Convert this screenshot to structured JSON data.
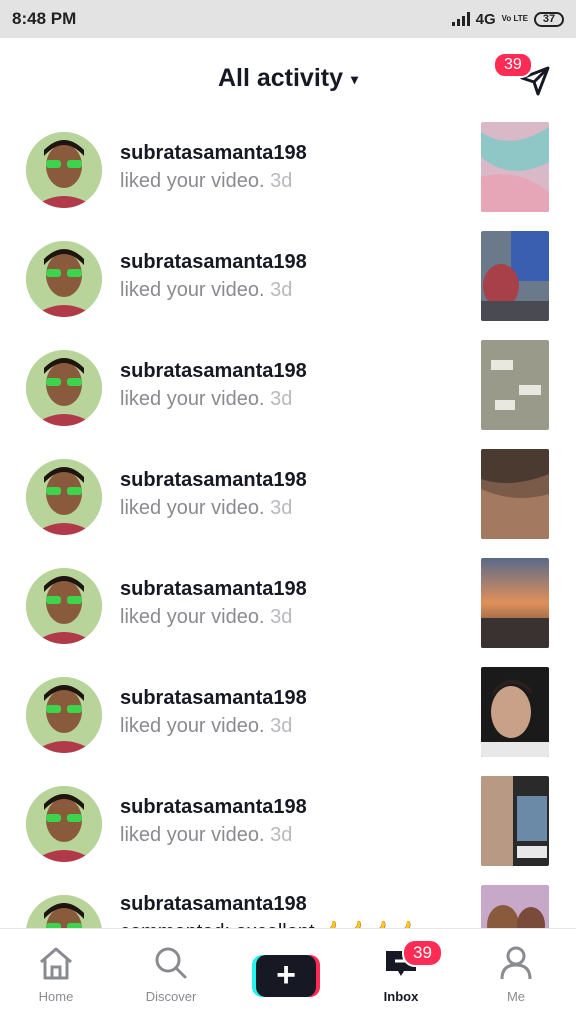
{
  "status": {
    "time": "8:48 PM",
    "network": "4G",
    "volte": "Vo LTE",
    "battery": "37"
  },
  "header": {
    "title": "All activity",
    "caret": "▾",
    "inbox_count": "39"
  },
  "activities": [
    {
      "username": "subratasamanta198",
      "action": "liked your video.",
      "age": "3d"
    },
    {
      "username": "subratasamanta198",
      "action": "liked your video.",
      "age": "3d"
    },
    {
      "username": "subratasamanta198",
      "action": "liked your video.",
      "age": "3d"
    },
    {
      "username": "subratasamanta198",
      "action": "liked your video.",
      "age": "3d"
    },
    {
      "username": "subratasamanta198",
      "action": "liked your video.",
      "age": "3d"
    },
    {
      "username": "subratasamanta198",
      "action": "liked your video.",
      "age": "3d"
    },
    {
      "username": "subratasamanta198",
      "action": "liked your video.",
      "age": "3d"
    },
    {
      "username": "subratasamanta198",
      "action": "commented: excellent 👍👍👍👍",
      "age": ""
    }
  ],
  "nav": {
    "home": "Home",
    "discover": "Discover",
    "create": "+",
    "inbox": "Inbox",
    "inbox_badge": "39",
    "me": "Me"
  }
}
